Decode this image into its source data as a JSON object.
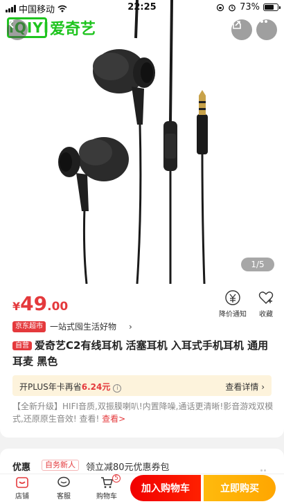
{
  "status_bar": {
    "carrier": "中国移动",
    "time": "22:25",
    "battery": "73%",
    "battery_level": 0.73
  },
  "header": {
    "logo_mark": "iQIYI",
    "logo_text": "爱奇艺"
  },
  "gallery": {
    "pager_current": "1",
    "pager_total": "5",
    "pager_text": "1/5"
  },
  "product": {
    "price_symbol": "¥",
    "price_int": "49",
    "price_dec": ".00",
    "price_notice_label": "降价通知",
    "favorite_label": "收藏",
    "store_tag": "京东超市",
    "store_slogan": "一站式囤生活好物",
    "store_chevron": "›",
    "self_tag": "自营",
    "title": "爱奇艺C2有线耳机 活塞耳机 入耳式手机耳机 通用耳麦 黑色",
    "plus_prefix": "开PLUS年卡再省",
    "plus_amount": "6.24元",
    "plus_info_icon": "i",
    "plus_detail": "查看详情 ›",
    "description": "【全新升级】HIFI音质,双振膜喇叭!内置降噪,通话更清晰!影音游戏双模式,还原原生音效!  查看!",
    "description_more": "查看>"
  },
  "coupon": {
    "heading": "优惠",
    "tag": "自务新人",
    "text": "领立减80元优惠券包"
  },
  "bottom_bar": {
    "store_label": "店铺",
    "service_label": "客服",
    "cart_label": "购物车",
    "cart_count": "5",
    "add_to_cart": "加入购物车",
    "buy_now": "立即购买"
  },
  "colors": {
    "price_red": "#e4393c",
    "logo_green": "#1ec41e",
    "buy_orange": "#ffa600"
  }
}
